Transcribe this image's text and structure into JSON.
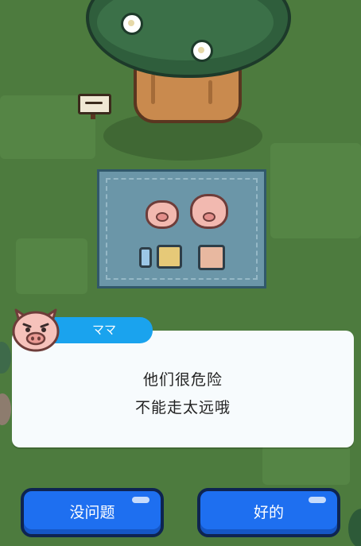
{
  "dialog": {
    "speaker": "ママ",
    "lines": [
      "他们很危险",
      "不能走太远哦"
    ]
  },
  "choices": [
    {
      "label": "没问题"
    },
    {
      "label": "好的"
    }
  ],
  "colors": {
    "grass": "#4d7b3e",
    "button": "#1e6ff0",
    "name_tag": "#1aa3ee",
    "dialog_bg": "#f7fbfd"
  }
}
